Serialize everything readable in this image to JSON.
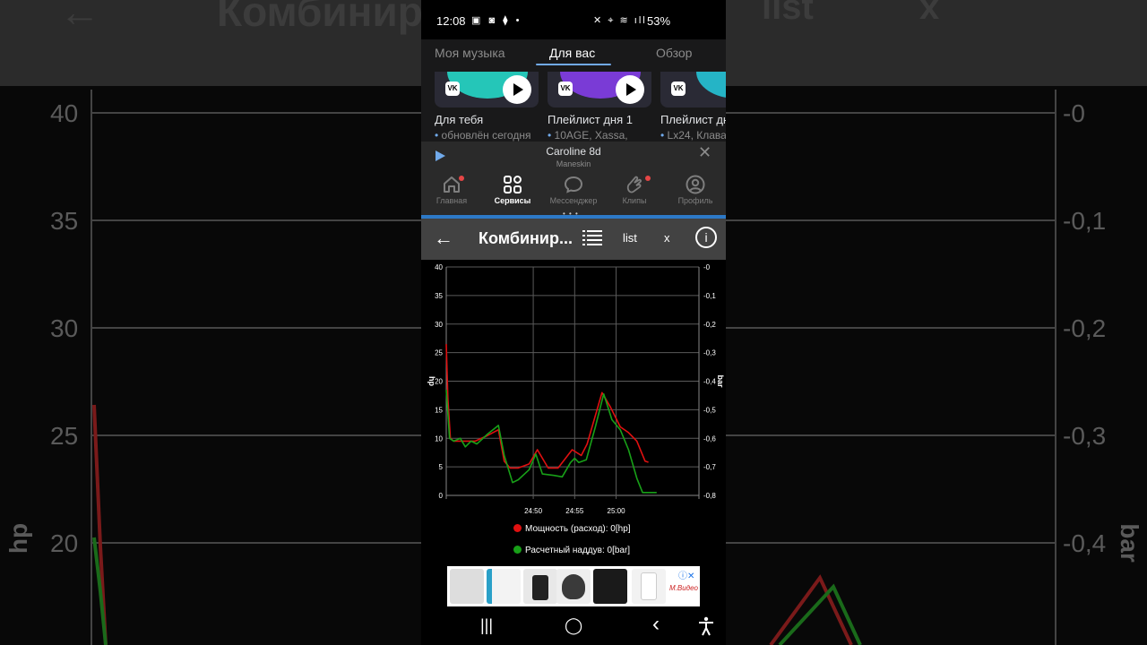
{
  "background": {
    "title_fragment": "Комбинир",
    "list_label": "list",
    "x_label": "x",
    "left_ticks": [
      "40",
      "35",
      "30",
      "25",
      "20"
    ],
    "right_ticks": [
      "-0",
      "-0,1",
      "-0,2",
      "-0,3",
      "-0,4"
    ],
    "left_axis_label": "hp",
    "right_axis_label": "bar"
  },
  "status_bar": {
    "time": "12:08",
    "battery": "53%"
  },
  "vk": {
    "tabs": [
      {
        "label": "Моя музыка"
      },
      {
        "label": "Для вас"
      },
      {
        "label": "Обзор"
      }
    ],
    "active_tab": "Для вас",
    "cards": [
      {
        "title": "Для тебя",
        "subtitle": "обновлён сегодня",
        "glow": "#25c6b8"
      },
      {
        "title": "Плейлист дня 1",
        "subtitle": "10AGE, Xassa,",
        "glow": "#7a3bd6"
      },
      {
        "title": "Плейлист дн",
        "subtitle": "Lx24, Клава",
        "glow": "#25b4c6"
      }
    ],
    "mini_player": {
      "title": "Caroline 8d",
      "artist": "Maneskin"
    },
    "bottom_nav": [
      {
        "label": "Главная",
        "icon": "home-icon"
      },
      {
        "label": "Сервисы",
        "icon": "services-icon"
      },
      {
        "label": "Мессенджер",
        "icon": "messenger-icon"
      },
      {
        "label": "Клипы",
        "icon": "clips-icon"
      },
      {
        "label": "Профиль",
        "icon": "profile-icon"
      }
    ],
    "active_nav": "Сервисы"
  },
  "app_toolbar": {
    "title": "Комбинир...",
    "list_label": "list",
    "x_label": "x",
    "info_glyph": "i"
  },
  "chart_data": {
    "type": "line",
    "x_ticks": [
      "24:50",
      "24:55",
      "25:00"
    ],
    "xlim": [
      -15.5,
      15
    ],
    "left_axis": {
      "label": "hp",
      "ylim": [
        0,
        40
      ],
      "ticks": [
        "0",
        "5",
        "10",
        "15",
        "20",
        "25",
        "30",
        "35",
        "40"
      ]
    },
    "right_axis": {
      "label": "bar",
      "ylim": [
        -0.8,
        0
      ],
      "ticks": [
        "-0,8",
        "-0,7",
        "-0,6",
        "-0,5",
        "-0,4",
        "-0,3",
        "-0,2",
        "-0,1",
        "-0"
      ]
    },
    "grid": true,
    "series": [
      {
        "name": "Мощность (расход): 0[hp]",
        "axis": "left",
        "color": "#e01010",
        "points": [
          [
            -15.5,
            26.5
          ],
          [
            -15.3,
            17
          ],
          [
            -15,
            10
          ],
          [
            -14.6,
            9.5
          ],
          [
            -13.5,
            9.5
          ],
          [
            -12,
            9.5
          ],
          [
            -10.5,
            10.5
          ],
          [
            -9.2,
            11.5
          ],
          [
            -8.5,
            6
          ],
          [
            -7.8,
            4.8
          ],
          [
            -6.8,
            4.8
          ],
          [
            -5.5,
            5.5
          ],
          [
            -4.5,
            8
          ],
          [
            -3.2,
            4.8
          ],
          [
            -2,
            4.8
          ],
          [
            -0.3,
            8
          ],
          [
            0.8,
            7
          ],
          [
            1.5,
            9
          ],
          [
            3.3,
            18
          ],
          [
            4.3,
            15.5
          ],
          [
            5.5,
            12
          ],
          [
            6.5,
            11
          ],
          [
            7.5,
            9.5
          ],
          [
            8.5,
            6
          ],
          [
            8.9,
            5.8
          ]
        ]
      },
      {
        "name": "Расчетный наддув: 0[bar]",
        "axis": "right",
        "color": "#18a018",
        "points": [
          [
            -15.5,
            -0.43
          ],
          [
            -15.1,
            -0.6
          ],
          [
            -14.6,
            -0.61
          ],
          [
            -13.8,
            -0.6
          ],
          [
            -13.2,
            -0.63
          ],
          [
            -12.5,
            -0.61
          ],
          [
            -11.8,
            -0.62
          ],
          [
            -10.5,
            -0.585
          ],
          [
            -9.2,
            -0.555
          ],
          [
            -8.5,
            -0.66
          ],
          [
            -7.5,
            -0.755
          ],
          [
            -6.8,
            -0.745
          ],
          [
            -5.5,
            -0.71
          ],
          [
            -4.7,
            -0.655
          ],
          [
            -3.9,
            -0.725
          ],
          [
            -2.5,
            -0.73
          ],
          [
            -1.5,
            -0.735
          ],
          [
            -0.5,
            -0.685
          ],
          [
            0,
            -0.67
          ],
          [
            0.5,
            -0.685
          ],
          [
            1.4,
            -0.675
          ],
          [
            2.5,
            -0.56
          ],
          [
            3.5,
            -0.445
          ],
          [
            4.5,
            -0.535
          ],
          [
            5.5,
            -0.57
          ],
          [
            6.5,
            -0.64
          ],
          [
            7.5,
            -0.74
          ],
          [
            8.2,
            -0.79
          ],
          [
            9,
            -0.79
          ],
          [
            9.9,
            -0.79
          ]
        ]
      }
    ]
  },
  "ad": {
    "brand": "М.Видео"
  },
  "system_nav": {
    "recents": "|||",
    "home": "◯",
    "back": "‹",
    "accessibility": "accessibility-icon"
  }
}
